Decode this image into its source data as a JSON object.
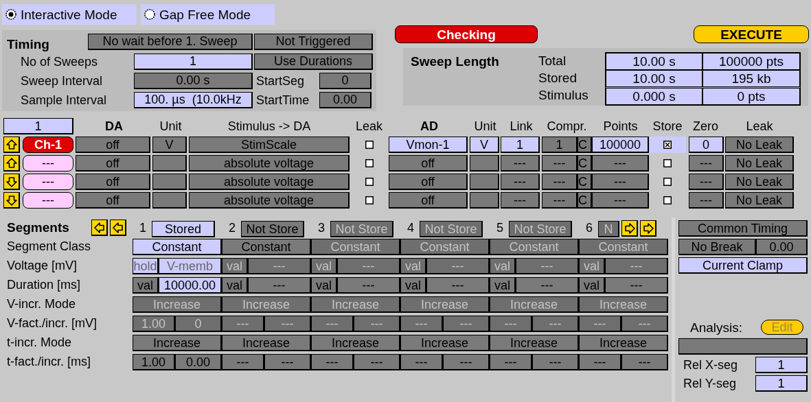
{
  "modes": [
    {
      "label": "Interactive Mode",
      "selected": true
    },
    {
      "label": "Gap Free Mode",
      "selected": false
    }
  ],
  "timing": {
    "title": "Timing",
    "wait_button": {
      "text": "No wait before 1. Sweep",
      "kind": "dark"
    },
    "trigger_button": {
      "text": "Not Triggered",
      "kind": "dark"
    },
    "rows": [
      {
        "label": "No of Sweeps",
        "value": {
          "text": "1",
          "kind": "light"
        },
        "side_button": {
          "text": "Use Durations",
          "kind": "dark"
        }
      },
      {
        "label": "Sweep Interval",
        "value": {
          "text": "0.00 s",
          "kind": "dark"
        },
        "side_label": "StartSeg",
        "side_value": {
          "text": "0",
          "kind": "dark"
        }
      },
      {
        "label": "Sample Interval",
        "value": {
          "text": "100. µs  (10.0kHz",
          "kind": "light"
        },
        "side_label": "StartTime",
        "side_value": {
          "text": "0.00",
          "kind": "dark"
        }
      }
    ]
  },
  "checking_button": "Checking",
  "execute_button": "EXECUTE",
  "sweep_length": {
    "title": "Sweep Length",
    "rows": [
      {
        "label": "Total",
        "time": "10.00 s",
        "size": "100000 pts"
      },
      {
        "label": "Stored",
        "time": "10.00 s",
        "size": "195 kb"
      },
      {
        "label": "Stimulus",
        "time": "0.000 s",
        "size": "0 pts"
      }
    ]
  },
  "channels": {
    "channel_number": "1",
    "columns": [
      {
        "text": "DA",
        "bold": true
      },
      {
        "text": "Unit",
        "bold": false
      },
      {
        "text": "Stimulus -> DA",
        "bold": false
      },
      {
        "text": "Leak",
        "bold": false
      },
      {
        "text": "AD",
        "bold": true
      },
      {
        "text": "Unit",
        "bold": false
      },
      {
        "text": "Link",
        "bold": false
      },
      {
        "text": "Compr.",
        "bold": false
      },
      {
        "text": "Points",
        "bold": false
      },
      {
        "text": "Store",
        "bold": false
      },
      {
        "text": "Zero",
        "bold": false
      },
      {
        "text": "Leak",
        "bold": false
      }
    ],
    "rows": [
      {
        "kind": "up",
        "name": {
          "text": "Ch-1",
          "kind": "active"
        },
        "da": {
          "text": "off",
          "kind": "dark"
        },
        "da_unit": {
          "text": "V",
          "kind": "dark"
        },
        "stimulus": {
          "text": "StimScale",
          "kind": "dark"
        },
        "leak": false,
        "ad": {
          "text": "Vmon-1",
          "kind": "light"
        },
        "ad_unit": {
          "text": "V",
          "kind": "light"
        },
        "link": {
          "text": "1",
          "kind": "light"
        },
        "compr": {
          "text": "1",
          "kind": "dark"
        },
        "compr_mode": {
          "text": "C",
          "kind": "dark"
        },
        "points": {
          "text": "100000",
          "kind": "light"
        },
        "store": true,
        "zero": {
          "text": "0",
          "kind": "light"
        },
        "ad_leak": {
          "text": "No Leak",
          "kind": "dark"
        }
      },
      {
        "kind": "up",
        "name": {
          "text": "---",
          "kind": "empty"
        },
        "da": {
          "text": "off",
          "kind": "dark"
        },
        "da_unit": {
          "kind": "dark"
        },
        "stimulus": {
          "text": "absolute voltage",
          "kind": "dark"
        },
        "leak": false,
        "ad": {
          "text": "off",
          "kind": "dark"
        },
        "ad_unit": {
          "kind": "dark"
        },
        "link": {
          "text": "---",
          "kind": "dark"
        },
        "compr": {
          "text": "---",
          "kind": "dark"
        },
        "compr_mode": {
          "text": "C",
          "kind": "dark"
        },
        "points": {
          "text": "---",
          "kind": "dark"
        },
        "store": false,
        "zero": {
          "text": "---",
          "kind": "dark"
        },
        "ad_leak": {
          "text": "No Leak",
          "kind": "dark"
        }
      },
      {
        "kind": "down",
        "name": {
          "text": "---",
          "kind": "empty"
        },
        "da": {
          "text": "off",
          "kind": "dark"
        },
        "da_unit": {
          "kind": "dark"
        },
        "stimulus": {
          "text": "absolute voltage",
          "kind": "dark"
        },
        "leak": false,
        "ad": {
          "text": "off",
          "kind": "dark"
        },
        "ad_unit": {
          "kind": "dark"
        },
        "link": {
          "text": "---",
          "kind": "dark"
        },
        "compr": {
          "text": "---",
          "kind": "dark"
        },
        "compr_mode": {
          "text": "C",
          "kind": "dark"
        },
        "points": {
          "text": "---",
          "kind": "dark"
        },
        "store": false,
        "zero": {
          "text": "---",
          "kind": "dark"
        },
        "ad_leak": {
          "text": "No Leak",
          "kind": "dark"
        }
      },
      {
        "kind": "down",
        "name": {
          "text": "---",
          "kind": "empty"
        },
        "da": {
          "text": "off",
          "kind": "dark"
        },
        "da_unit": {
          "kind": "dark"
        },
        "stimulus": {
          "text": "absolute voltage",
          "kind": "dark"
        },
        "leak": false,
        "ad": {
          "text": "off",
          "kind": "dark"
        },
        "ad_unit": {
          "kind": "dark"
        },
        "link": {
          "text": "---",
          "kind": "dark"
        },
        "compr": {
          "text": "---",
          "kind": "dark"
        },
        "compr_mode": {
          "text": "C",
          "kind": "dark"
        },
        "points": {
          "text": "---",
          "kind": "dark"
        },
        "store": false,
        "zero": {
          "text": "---",
          "kind": "dark"
        },
        "ad_leak": {
          "text": "No Leak",
          "kind": "dark"
        }
      }
    ]
  },
  "segments": {
    "title": "Segments",
    "row_labels": [
      "Segment Class",
      "Voltage [mV]",
      "Duration [ms]",
      "V-incr. Mode",
      "V-fact./incr. [mV]",
      "t-incr. Mode",
      "t-fact./incr. [ms]"
    ],
    "items": [
      {
        "number": "1",
        "storage": {
          "text": "Stored",
          "kind": "light"
        },
        "class": {
          "text": "Constant",
          "kind": "light"
        },
        "voltage": [
          {
            "text": "hold",
            "kind": "lightdim"
          },
          {
            "text": "V-memb",
            "kind": "lightdim"
          }
        ],
        "duration": [
          {
            "text": "val",
            "kind": "dark"
          },
          {
            "text": "10000.00",
            "kind": "light"
          }
        ],
        "v_incr_mode": {
          "text": "Increase",
          "kind": "dim"
        },
        "v_fact": [
          {
            "text": "1.00",
            "kind": "dim"
          },
          {
            "text": "0",
            "kind": "dim"
          }
        ],
        "t_incr_mode": {
          "text": "Increase",
          "kind": "dark"
        },
        "t_fact": [
          {
            "text": "1.00",
            "kind": "dark"
          },
          {
            "text": "0.00",
            "kind": "dark"
          }
        ]
      },
      {
        "number": "2",
        "storage": {
          "text": "Not Store",
          "kind": "dark"
        },
        "class": {
          "text": "Constant",
          "kind": "dark"
        },
        "voltage": [
          {
            "text": "val",
            "kind": "dim"
          },
          {
            "text": "---",
            "kind": "dim"
          }
        ],
        "duration": [
          {
            "text": "val",
            "kind": "dark"
          },
          {
            "text": "---",
            "kind": "dark"
          }
        ],
        "v_incr_mode": {
          "text": "Increase",
          "kind": "dim"
        },
        "v_fact": [
          {
            "text": "---",
            "kind": "dim"
          },
          {
            "text": "---",
            "kind": "dim"
          }
        ],
        "t_incr_mode": {
          "text": "Increase",
          "kind": "dark"
        },
        "t_fact": [
          {
            "text": "---",
            "kind": "dark"
          },
          {
            "text": "---",
            "kind": "dark"
          }
        ]
      },
      {
        "number": "3",
        "storage": {
          "text": "Not Store",
          "kind": "dim"
        },
        "class": {
          "text": "Constant",
          "kind": "dim"
        },
        "voltage": [
          {
            "text": "val",
            "kind": "dim"
          },
          {
            "text": "---",
            "kind": "dim"
          }
        ],
        "duration": [
          {
            "text": "val",
            "kind": "dark"
          },
          {
            "text": "---",
            "kind": "dark"
          }
        ],
        "v_incr_mode": {
          "text": "Increase",
          "kind": "dim"
        },
        "v_fact": [
          {
            "text": "---",
            "kind": "dim"
          },
          {
            "text": "---",
            "kind": "dim"
          }
        ],
        "t_incr_mode": {
          "text": "Increase",
          "kind": "dark"
        },
        "t_fact": [
          {
            "text": "---",
            "kind": "dark"
          },
          {
            "text": "---",
            "kind": "dark"
          }
        ]
      },
      {
        "number": "4",
        "storage": {
          "text": "Not Store",
          "kind": "dim"
        },
        "class": {
          "text": "Constant",
          "kind": "dim"
        },
        "voltage": [
          {
            "text": "val",
            "kind": "dim"
          },
          {
            "text": "---",
            "kind": "dim"
          }
        ],
        "duration": [
          {
            "text": "val",
            "kind": "dark"
          },
          {
            "text": "---",
            "kind": "dark"
          }
        ],
        "v_incr_mode": {
          "text": "Increase",
          "kind": "dim"
        },
        "v_fact": [
          {
            "text": "---",
            "kind": "dim"
          },
          {
            "text": "---",
            "kind": "dim"
          }
        ],
        "t_incr_mode": {
          "text": "Increase",
          "kind": "dark"
        },
        "t_fact": [
          {
            "text": "---",
            "kind": "dark"
          },
          {
            "text": "---",
            "kind": "dark"
          }
        ]
      },
      {
        "number": "5",
        "storage": {
          "text": "Not Store",
          "kind": "dim"
        },
        "class": {
          "text": "Constant",
          "kind": "dim"
        },
        "voltage": [
          {
            "text": "val",
            "kind": "dim"
          },
          {
            "text": "---",
            "kind": "dim"
          }
        ],
        "duration": [
          {
            "text": "val",
            "kind": "dark"
          },
          {
            "text": "---",
            "kind": "dark"
          }
        ],
        "v_incr_mode": {
          "text": "Increase",
          "kind": "dim"
        },
        "v_fact": [
          {
            "text": "---",
            "kind": "dim"
          },
          {
            "text": "---",
            "kind": "dim"
          }
        ],
        "t_incr_mode": {
          "text": "Increase",
          "kind": "dark"
        },
        "t_fact": [
          {
            "text": "---",
            "kind": "dark"
          },
          {
            "text": "---",
            "kind": "dark"
          }
        ]
      },
      {
        "number": "6",
        "storage": {
          "text": "N",
          "kind": "dim"
        },
        "class": {
          "text": "Constant",
          "kind": "dim"
        },
        "voltage": [
          {
            "text": "val",
            "kind": "dim"
          },
          {
            "text": "---",
            "kind": "dim"
          }
        ],
        "duration": [
          {
            "text": "val",
            "kind": "dark"
          },
          {
            "text": "---",
            "kind": "dark"
          }
        ],
        "v_incr_mode": {
          "text": "Increase",
          "kind": "dim"
        },
        "v_fact": [
          {
            "text": "---",
            "kind": "dim"
          },
          {
            "text": "---",
            "kind": "dim"
          }
        ],
        "t_incr_mode": {
          "text": "Increase",
          "kind": "dark"
        },
        "t_fact": [
          {
            "text": "---",
            "kind": "dark"
          },
          {
            "text": "---",
            "kind": "dark"
          }
        ]
      }
    ]
  },
  "side_panel": {
    "common_timing": {
      "text": "Common Timing",
      "kind": "dark"
    },
    "break_mode": {
      "text": "No Break",
      "kind": "dark"
    },
    "break_value": {
      "text": "0.00",
      "kind": "dark"
    },
    "clamp_mode": {
      "text": "Current Clamp",
      "kind": "light"
    },
    "analysis_label": "Analysis:",
    "analysis_edit": "Edit",
    "analysis_field": {
      "kind": "dark"
    },
    "rel_rows": [
      {
        "label": "Rel X-seg",
        "value": {
          "text": "1",
          "kind": "light"
        }
      },
      {
        "label": "Rel Y-seg",
        "value": {
          "text": "1",
          "kind": "light"
        }
      }
    ]
  }
}
